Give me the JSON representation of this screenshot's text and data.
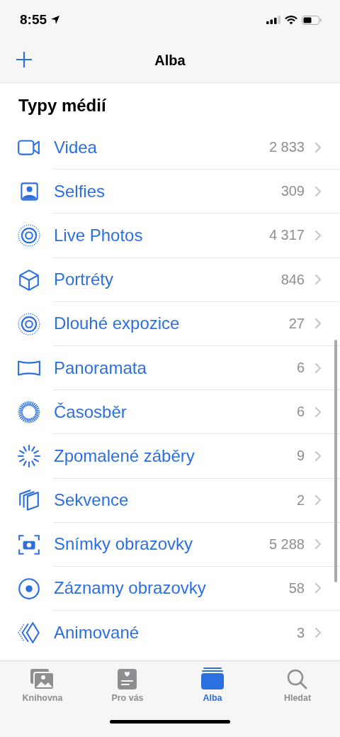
{
  "status_bar": {
    "time": "8:55"
  },
  "nav_bar": {
    "title": "Alba"
  },
  "section": {
    "title": "Typy médií"
  },
  "albums": [
    {
      "kind": "video",
      "name": "Videa",
      "count": "2 833"
    },
    {
      "kind": "selfie",
      "name": "Selfies",
      "count": "309"
    },
    {
      "kind": "live",
      "name": "Live Photos",
      "count": "4 317"
    },
    {
      "kind": "portrait",
      "name": "Portréty",
      "count": "846"
    },
    {
      "kind": "live",
      "name": "Dlouhé expozice",
      "count": "27"
    },
    {
      "kind": "panorama",
      "name": "Panoramata",
      "count": "6"
    },
    {
      "kind": "timelapse",
      "name": "Časosběr",
      "count": "6"
    },
    {
      "kind": "slomo",
      "name": "Zpomalené záběry",
      "count": "9"
    },
    {
      "kind": "burst",
      "name": "Sekvence",
      "count": "2"
    },
    {
      "kind": "screenshot",
      "name": "Snímky obrazovky",
      "count": "5 288"
    },
    {
      "kind": "recording",
      "name": "Záznamy obrazovky",
      "count": "58"
    },
    {
      "kind": "animated",
      "name": "Animované",
      "count": "3"
    }
  ],
  "tab_bar": [
    {
      "kind": "library",
      "label": "Knihovna",
      "selected": false
    },
    {
      "kind": "foryou",
      "label": "Pro vás",
      "selected": false
    },
    {
      "kind": "albums",
      "label": "Alba",
      "selected": true
    },
    {
      "kind": "search",
      "label": "Hledat",
      "selected": false
    }
  ]
}
